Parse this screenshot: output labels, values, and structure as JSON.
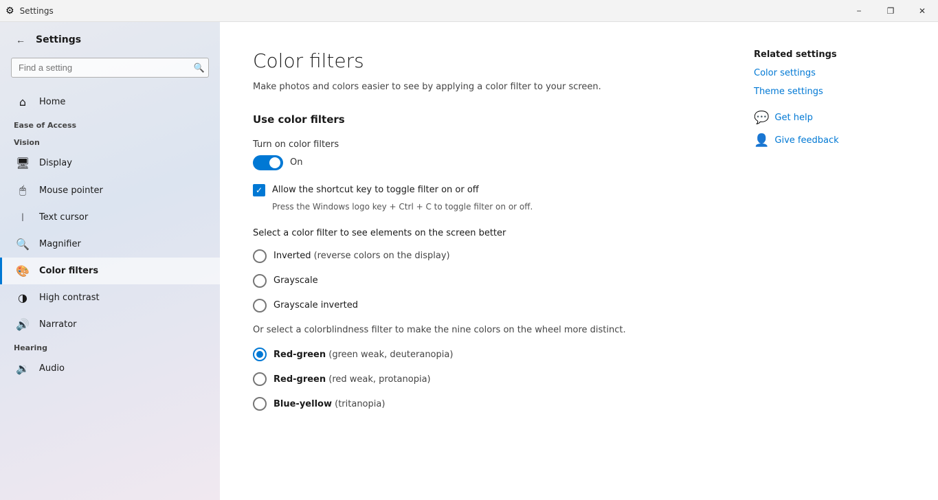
{
  "titlebar": {
    "title": "Settings",
    "minimize_label": "−",
    "maximize_label": "❐",
    "close_label": "✕"
  },
  "sidebar": {
    "back_button_label": "←",
    "app_title": "Settings",
    "search_placeholder": "Find a setting",
    "category_label": "Ease of Access",
    "vision_label": "Vision",
    "items": [
      {
        "id": "home",
        "label": "Home",
        "icon": "⌂"
      },
      {
        "id": "display",
        "label": "Display",
        "icon": "🖥"
      },
      {
        "id": "mouse-pointer",
        "label": "Mouse pointer",
        "icon": "🖱"
      },
      {
        "id": "text-cursor",
        "label": "Text cursor",
        "icon": "I"
      },
      {
        "id": "magnifier",
        "label": "Magnifier",
        "icon": "🔍"
      },
      {
        "id": "color-filters",
        "label": "Color filters",
        "icon": "🎨"
      },
      {
        "id": "high-contrast",
        "label": "High contrast",
        "icon": "◑"
      },
      {
        "id": "narrator",
        "label": "Narrator",
        "icon": "🔊"
      }
    ],
    "hearing_label": "Hearing",
    "hearing_items": [
      {
        "id": "audio",
        "label": "Audio",
        "icon": "🔉"
      }
    ]
  },
  "content": {
    "page_title": "Color filters",
    "page_desc": "Make photos and colors easier to see by applying a color filter to your screen.",
    "section_title": "Use color filters",
    "toggle_label": "Turn on color filters",
    "toggle_state": "On",
    "toggle_active": true,
    "checkbox_label": "Allow the shortcut key to toggle filter on or off",
    "checkbox_checked": true,
    "shortcut_hint": "Press the Windows logo key  + Ctrl + C to toggle filter on or off.",
    "filter_select_label": "Select a color filter to see elements on the screen better",
    "filters": [
      {
        "id": "inverted",
        "label": "Inverted",
        "sublabel": "(reverse colors on the display)",
        "selected": false
      },
      {
        "id": "grayscale",
        "label": "Grayscale",
        "sublabel": "",
        "selected": false
      },
      {
        "id": "grayscale-inverted",
        "label": "Grayscale inverted",
        "sublabel": "",
        "selected": false
      }
    ],
    "colorblind_desc": "Or select a colorblindness filter to make the nine colors on the wheel more distinct.",
    "colorblind_filters": [
      {
        "id": "red-green-weak",
        "label": "Red-green",
        "sublabel": "(green weak, deuteranopia)",
        "selected": true
      },
      {
        "id": "red-green-strong",
        "label": "Red-green",
        "sublabel": "(red weak, protanopia)",
        "selected": false
      },
      {
        "id": "blue-yellow",
        "label": "Blue-yellow",
        "sublabel": "(tritanopia)",
        "selected": false
      }
    ]
  },
  "related": {
    "title": "Related settings",
    "links": [
      {
        "id": "color-settings",
        "label": "Color settings"
      },
      {
        "id": "theme-settings",
        "label": "Theme settings"
      }
    ],
    "actions": [
      {
        "id": "get-help",
        "label": "Get help",
        "icon": "💬"
      },
      {
        "id": "give-feedback",
        "label": "Give feedback",
        "icon": "👤"
      }
    ]
  }
}
